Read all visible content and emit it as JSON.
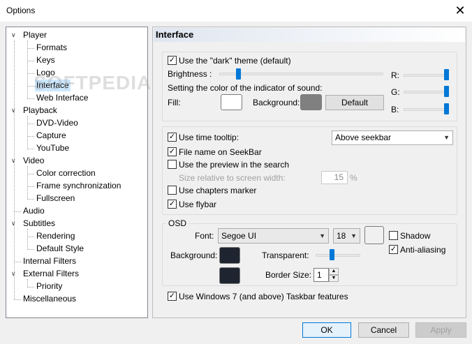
{
  "window": {
    "title": "Options",
    "close_glyph": "✕"
  },
  "watermark": "SOFTPEDIA",
  "tree": {
    "items": [
      {
        "label": "Player",
        "level": 0,
        "expanded": true
      },
      {
        "label": "Formats",
        "level": 1
      },
      {
        "label": "Keys",
        "level": 1
      },
      {
        "label": "Logo",
        "level": 1
      },
      {
        "label": "Interface",
        "level": 1,
        "selected": true
      },
      {
        "label": "Web Interface",
        "level": 1
      },
      {
        "label": "Playback",
        "level": 0,
        "expanded": true
      },
      {
        "label": "DVD-Video",
        "level": 1
      },
      {
        "label": "Capture",
        "level": 1
      },
      {
        "label": "YouTube",
        "level": 1
      },
      {
        "label": "Video",
        "level": 0,
        "expanded": true
      },
      {
        "label": "Color correction",
        "level": 1
      },
      {
        "label": "Frame synchronization",
        "level": 1
      },
      {
        "label": "Fullscreen",
        "level": 1
      },
      {
        "label": "Audio",
        "level": 0
      },
      {
        "label": "Subtitles",
        "level": 0,
        "expanded": true
      },
      {
        "label": "Rendering",
        "level": 1
      },
      {
        "label": "Default Style",
        "level": 1
      },
      {
        "label": "Internal Filters",
        "level": 0
      },
      {
        "label": "External Filters",
        "level": 0,
        "expanded": true
      },
      {
        "label": "Priority",
        "level": 1
      },
      {
        "label": "Miscellaneous",
        "level": 0
      }
    ]
  },
  "panel": {
    "header": "Interface",
    "theme": {
      "dark_theme_label": "Use the \"dark\" theme (default)",
      "dark_theme_checked": true,
      "brightness_label": "Brightness :",
      "brightness_value": 0.07,
      "indicator_label": "Setting the color of the indicator of sound:",
      "fill_label": "Fill:",
      "fill_color": "#ffffff",
      "background_label": "Background:",
      "background_color": "#808080",
      "default_button": "Default",
      "r_label": "R:",
      "r_value": 1.0,
      "g_label": "G:",
      "g_value": 1.0,
      "b_label": "B:",
      "b_value": 1.0
    },
    "seekbar": {
      "time_tooltip_label": "Use time tooltip:",
      "time_tooltip_checked": true,
      "tooltip_position": "Above seekbar",
      "file_name_label": "File name on SeekBar",
      "file_name_checked": true,
      "preview_label": "Use the preview in the search",
      "preview_checked": false,
      "size_relative_label": "Size relative to screen width:",
      "size_relative_value": "15",
      "size_relative_unit": "%",
      "chapters_label": "Use chapters marker",
      "chapters_checked": false,
      "flybar_label": "Use flybar",
      "flybar_checked": true
    },
    "osd": {
      "group_label": "OSD",
      "font_label": "Font:",
      "font_value": "Segoe UI",
      "size_value": "18",
      "font_color": "#f0f0f0",
      "shadow_label": "Shadow",
      "shadow_checked": false,
      "antialias_label": "Anti-aliasing",
      "antialias_checked": true,
      "background_label": "Background:",
      "background_color": "#1e2530",
      "transparent_label": "Transparent:",
      "transparent_value": 0.35,
      "border_color": "#1e2530",
      "border_size_label": "Border Size:",
      "border_size_value": "1"
    },
    "taskbar_label": "Use Windows 7 (and above) Taskbar features",
    "taskbar_checked": true
  },
  "buttons": {
    "ok": "OK",
    "cancel": "Cancel",
    "apply": "Apply"
  },
  "check_glyph": "✓"
}
